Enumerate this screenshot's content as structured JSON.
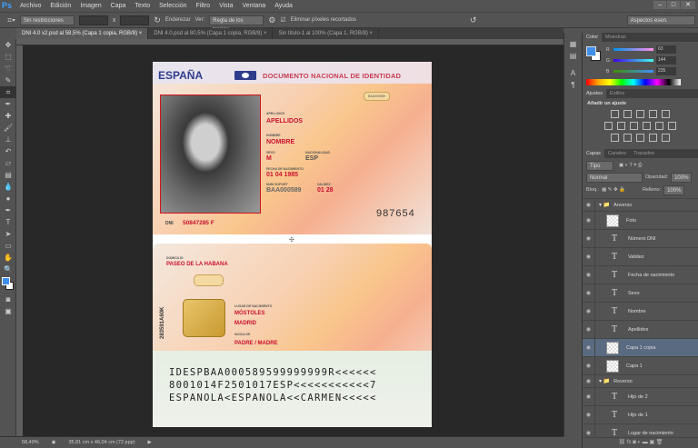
{
  "app": {
    "logo": "Ps",
    "menu": [
      "Archivo",
      "Edición",
      "Imagen",
      "Capa",
      "Texto",
      "Selección",
      "Filtro",
      "Vista",
      "Ventana",
      "Ayuda"
    ],
    "window_controls": [
      "‒",
      "□",
      "✕"
    ]
  },
  "options": {
    "ratio": "Sin restricciones",
    "swap": "x",
    "straighten": "Enderezar",
    "view_label": "Ver:",
    "view_value": "Regla de los tercios",
    "delete_cropped": "Eliminar píxeles recortados",
    "workspace": "Aspectos esen."
  },
  "tabs": [
    "DNI 4.0 x2.psd al 58,5% (Capa 1 copia, RGB/8) ×",
    "DNI 4.0.psd al 80,5% (Capa 1 copia, RGB/8) ×",
    "Sin título-1 al 100% (Capa 1, RGB/8) ×"
  ],
  "card_front": {
    "country": "ESPAÑA",
    "doc_title": "DOCUMENTO NACIONAL DE IDENTIDAD",
    "stamp": "BAA000589",
    "apellidos_label": "APELLIDOS",
    "apellidos": "APELLIDOS",
    "nombre_label": "NOMBRE",
    "nombre": "NOMBRE",
    "sexo_label": "SEXO",
    "sexo": "M",
    "nac_label": "NACIONALIDAD",
    "nac": "ESP",
    "fecha_label": "FECHA DE NACIMIENTO",
    "fecha": "01 04 1985",
    "idesp_label": "NUM SOPORT",
    "idesp": "BAA000589",
    "validez_label": "VALIDEZ",
    "validez": "01 28",
    "can": "987654",
    "dni_label": "DNI",
    "dni": "50847285 F"
  },
  "card_back": {
    "domicilio_label": "DOMICILIO",
    "domicilio": "PASEO DE LA HABANA",
    "equipo": "283591A60K",
    "lugar_label": "LUGAR DE NACIMIENTO",
    "lugar1": "MÓSTOLES",
    "lugar2": "MADRID",
    "hijo_label": "HIJO/A DE",
    "padres": "PADRE / MADRE",
    "mrz": [
      "IDESPBAA000589599999999R<<<<<<",
      "8001014F2501017ESP<<<<<<<<<<<7",
      "ESPANOLA<ESPANOLA<<CARMEN<<<<<"
    ]
  },
  "color_panel": {
    "tabs": [
      "Color",
      "Muestras"
    ],
    "r": "63",
    "g": "144",
    "b": "235",
    "fg": "#3f90eb"
  },
  "adjust_panel": {
    "tabs": [
      "Ajustes",
      "Estilos"
    ],
    "title": "Añadir un ajuste"
  },
  "layers_panel": {
    "tabs": [
      "Capas",
      "Canales",
      "Trazados"
    ],
    "filter": "Tipo",
    "blend": "Normal",
    "opacity_label": "Opacidad:",
    "opacity": "100%",
    "lock_label": "Bloq.:",
    "fill_label": "Relleno:",
    "fill": "100%",
    "layers": [
      {
        "name": "Anverso",
        "kind": "group"
      },
      {
        "name": "Foto",
        "kind": "image"
      },
      {
        "name": "Número DNI",
        "kind": "text"
      },
      {
        "name": "Validez",
        "kind": "text"
      },
      {
        "name": "Fecha de nacimiento",
        "kind": "text"
      },
      {
        "name": "Sexo",
        "kind": "text"
      },
      {
        "name": "Nombre",
        "kind": "text"
      },
      {
        "name": "Apellidos",
        "kind": "text"
      },
      {
        "name": "Capa 1 copia",
        "kind": "image",
        "selected": true
      },
      {
        "name": "Capa 1",
        "kind": "image"
      },
      {
        "name": "Reverso",
        "kind": "group"
      },
      {
        "name": "Hijo de 2",
        "kind": "text"
      },
      {
        "name": "Hijo de 1",
        "kind": "text"
      },
      {
        "name": "Lugar de nacimiento",
        "kind": "text"
      }
    ]
  },
  "status": {
    "zoom": "58,49%",
    "size": "35,81 cm x 46,04 cm (72 ppp)"
  }
}
